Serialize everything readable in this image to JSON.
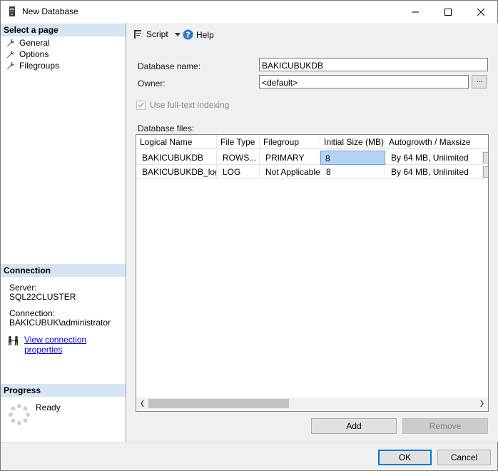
{
  "window": {
    "title": "New Database"
  },
  "left": {
    "select_header": "Select a page",
    "pages": [
      {
        "label": "General"
      },
      {
        "label": "Options"
      },
      {
        "label": "Filegroups"
      }
    ],
    "connection_header": "Connection",
    "server_label": "Server:",
    "server_value": "SQL22CLUSTER",
    "connection_label": "Connection:",
    "connection_value": "BAKICUBUK\\administrator",
    "view_props_link": "View connection properties",
    "progress_header": "Progress",
    "progress_status": "Ready"
  },
  "toolbar": {
    "script_label": "Script",
    "help_label": "Help"
  },
  "form": {
    "db_name_label": "Database name:",
    "db_name_value": "BAKICUBUKDB",
    "owner_label": "Owner:",
    "owner_value": "<default>",
    "browse_label": "...",
    "fulltext_label": "Use full-text indexing",
    "files_label": "Database files:"
  },
  "grid": {
    "columns": [
      "Logical Name",
      "File Type",
      "Filegroup",
      "Initial Size (MB)",
      "Autogrowth / Maxsize"
    ],
    "rows": [
      [
        "BAKICUBUKDB",
        "ROWS...",
        "PRIMARY",
        "8",
        "By 64 MB, Unlimited"
      ],
      [
        "BAKICUBUKDB_log",
        "LOG",
        "Not Applicable",
        "8",
        "By 64 MB, Unlimited"
      ]
    ]
  },
  "buttons": {
    "add": "Add",
    "remove": "Remove",
    "ok": "OK",
    "cancel": "Cancel"
  },
  "colors": {
    "section_header": "#d7e4f2",
    "link": "#0000cc",
    "selection": "#b5d4f5",
    "default_button_border": "#0078d7"
  }
}
